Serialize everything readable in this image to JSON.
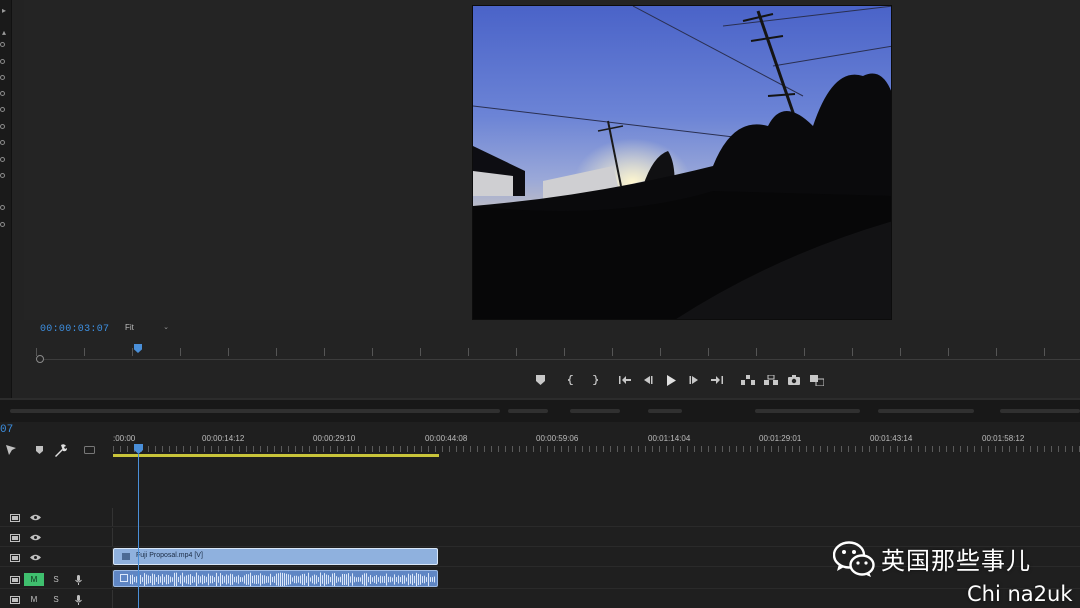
{
  "program_monitor": {
    "timecode": "00:00:03:07",
    "zoom": "Fit"
  },
  "transport": {
    "icons": [
      "add-marker-icon",
      "mark-in-icon",
      "mark-out-icon",
      "go-to-in-icon",
      "step-back-icon",
      "play-icon",
      "step-forward-icon",
      "go-to-out-icon",
      "lift-icon",
      "extract-icon",
      "export-frame-icon",
      "comparison-view-icon"
    ]
  },
  "sequence": {
    "timecode": "07",
    "ruler_labels": [
      ":00:00",
      "00:00:14:12",
      "00:00:29:10",
      "00:00:44:08",
      "00:00:59:06",
      "00:01:14:04",
      "00:01:29:01",
      "00:01:43:14",
      "00:01:58:12"
    ],
    "clip_video_label": "Fuji Proposal.mp4 [V]",
    "audio_m": "M",
    "audio_s": "S",
    "colors": {
      "playhead": "#4a8fd8",
      "workarea": "#c8c43a",
      "video_clip": "#8fb1de",
      "audio_clip": "#5f86c4",
      "mute_active": "#3fbf6e"
    }
  },
  "watermark": {
    "title": "英国那些事儿",
    "subtitle": "Chi na2uk"
  }
}
